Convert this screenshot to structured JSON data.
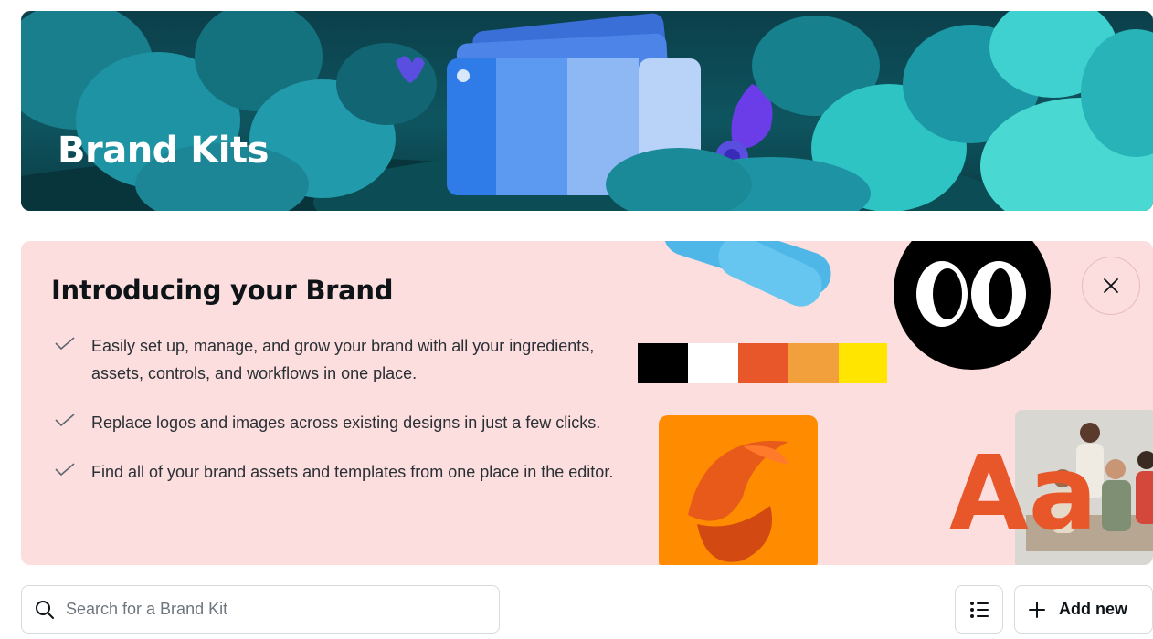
{
  "hero": {
    "title": "Brand Kits"
  },
  "intro": {
    "title": "Introducing your Brand",
    "benefits": [
      {
        "text": "Easily set up, manage, and grow your brand with all your ingredients, assets, controls, and workflows in one place."
      },
      {
        "text": "Replace logos and images across existing designs in just a few clicks."
      },
      {
        "text": "Find all of your brand assets and templates from one place in the editor."
      }
    ],
    "palette": [
      "#000000",
      "#ffffff",
      "#e8572a",
      "#f1a03c",
      "#ffe500"
    ],
    "sample_text": "Aa",
    "logo_text": "co"
  },
  "toolbar": {
    "search_placeholder": "Search for a Brand Kit",
    "add_label": "Add new"
  },
  "icons": {
    "search": "search-icon",
    "close": "close-icon",
    "list_view": "list-view-icon",
    "add": "plus-icon",
    "check": "check-icon"
  },
  "colors": {
    "hero_bg": "#0b3f4a",
    "intro_bg": "#fbdedd",
    "text": "#0e1318",
    "border": "#d6d9dd"
  }
}
